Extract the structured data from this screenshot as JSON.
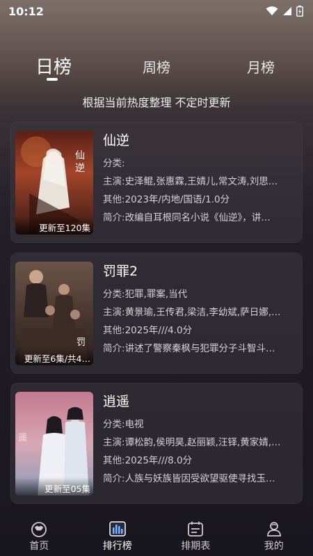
{
  "status_bar": {
    "time": "10:12"
  },
  "tabs": [
    {
      "label": "日榜",
      "active": true
    },
    {
      "label": "周榜",
      "active": false
    },
    {
      "label": "月榜",
      "active": false
    }
  ],
  "subtitle": "根据当前热度整理 不定时更新",
  "labels": {
    "category": "分类:",
    "cast": "主演:",
    "other": "其他:",
    "summary": "简介:"
  },
  "items": [
    {
      "title": "仙逆",
      "badge": "更新至120集",
      "category": "",
      "cast": "史泽鲲,张惠霖,王婧儿,常文涛,刘思…",
      "other": "2023年/内地/国语/1.0分",
      "summary": "改编自耳根同名小说《仙逆》，讲…"
    },
    {
      "title": "罚罪2",
      "badge": "更新至6集/共4…",
      "category": "犯罪,罪案,当代",
      "cast": "黄景瑜,王传君,梁洁,李幼斌,萨日娜,…",
      "other": "2025年///4.0分",
      "summary": "讲述了警察秦枫与犯罪分子斗智斗…"
    },
    {
      "title": "逍遥",
      "badge": "更新至05集",
      "category": "电视",
      "cast": "谭松韵,侯明昊,赵丽颖,汪铎,黄家婧,…",
      "other": "2025年///8.0分",
      "summary": "人族与妖族皆因受欲望驱使寻找玉…"
    }
  ],
  "bottom_nav": [
    {
      "label": "首页",
      "icon": "home-icon",
      "active": false
    },
    {
      "label": "排行榜",
      "icon": "ranking-icon",
      "active": true
    },
    {
      "label": "排期表",
      "icon": "calendar-icon",
      "active": false
    },
    {
      "label": "我的",
      "icon": "profile-icon",
      "active": false
    }
  ]
}
